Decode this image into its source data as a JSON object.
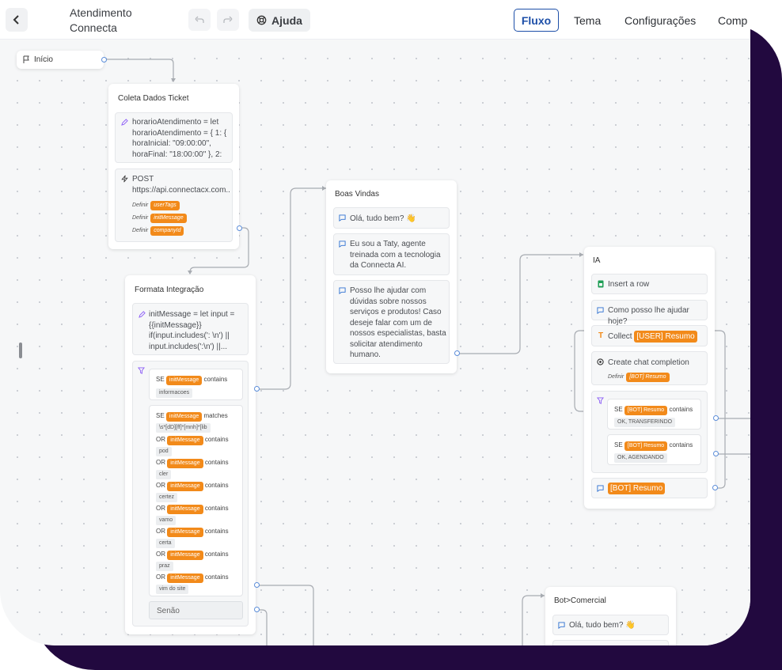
{
  "topbar": {
    "title": "Atendimento Connecta",
    "help_label": "Ajuda",
    "tabs": [
      "Fluxo",
      "Tema",
      "Configurações",
      "Comp"
    ]
  },
  "nodes": {
    "start": {
      "label": "Início"
    },
    "coleta": {
      "title": "Coleta Dados Ticket",
      "code": "horarioAtendimento = let horarioAtendimento = { 1: { horaInicial: \"09:00:00\", horaFinal: \"18:00:00\" }, 2: {...",
      "request_method": "POST",
      "request_url": "https://api.connectacx.com...",
      "define_label": "Definir",
      "vars": [
        "userTags",
        "initMessage",
        "companyId"
      ]
    },
    "formata": {
      "title": "Formata Integração",
      "code": "initMessage = let input = {{initMessage}} if(input.includes(': \\n') || input.includes(':\\n') ||...",
      "cond1": {
        "se": "SE",
        "var": "initMessage",
        "op": "contains",
        "value": "informacoes"
      },
      "cond2_first": {
        "se": "SE",
        "var": "initMessage",
        "op": "matches",
        "value": "\\s*[dD][ff]*[mnh]*[lib"
      },
      "cond2_rest": [
        {
          "or": "OR",
          "var": "initMessage",
          "op": "contains",
          "value": "pod"
        },
        {
          "or": "OR",
          "var": "initMessage",
          "op": "contains",
          "value": "cler"
        },
        {
          "or": "OR",
          "var": "initMessage",
          "op": "contains",
          "value": "certez"
        },
        {
          "or": "OR",
          "var": "initMessage",
          "op": "contains",
          "value": "vamo"
        },
        {
          "or": "OR",
          "var": "initMessage",
          "op": "contains",
          "value": "certa"
        },
        {
          "or": "OR",
          "var": "initMessage",
          "op": "contains",
          "value": "praz"
        },
        {
          "or": "OR",
          "var": "initMessage",
          "op": "contains",
          "value": "vim do site"
        }
      ],
      "else_label": "Senão"
    },
    "boas": {
      "title": "Boas Vindas",
      "msgs": [
        "Olá, tudo bem? 👋",
        "Eu sou a Taty, agente treinada com a tecnologia da Connecta AI.",
        "Posso lhe ajudar com dúvidas sobre nossos serviços e produtos! Caso deseje falar com um de nossos especialistas, basta solicitar atendimento humano."
      ]
    },
    "ia": {
      "title": "IA",
      "insert_row": "Insert a row",
      "question": "Como posso lhe ajudar hoje?",
      "collect_label": "Collect",
      "collect_var": "[USER] Resumo",
      "completion": "Create chat completion",
      "define_label": "Definir",
      "completion_var": "[BOT] Resumo",
      "cond1": {
        "se": "SE",
        "var": "[BOT] Resumo",
        "op": "contains",
        "value": "OK, TRANSFERINDO"
      },
      "cond2": {
        "se": "SE",
        "var": "[BOT] Resumo",
        "op": "contains",
        "value": "OK, AGENDANDO"
      },
      "bot_var": "[BOT] Resumo"
    },
    "comercial": {
      "title": "Bot>Comercial",
      "msg": "Olá, tudo bem? 👋"
    }
  },
  "colors": {
    "accent": "#1d4fa8",
    "tag": "#f28a1a",
    "frame": "#22093f",
    "handle": "#5b8dd9"
  }
}
